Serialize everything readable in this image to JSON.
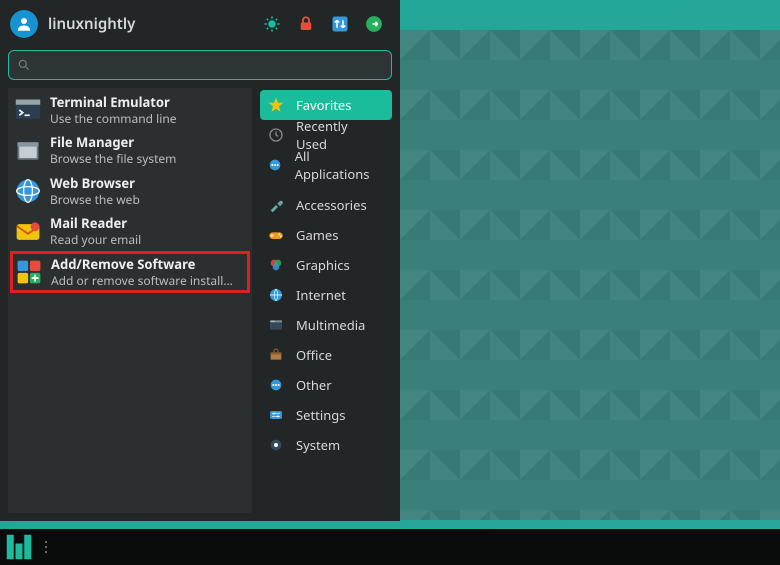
{
  "user": {
    "name": "linuxnightly"
  },
  "search": {
    "placeholder": ""
  },
  "header_actions": [
    {
      "name": "settings",
      "color": "#1abc9c"
    },
    {
      "name": "lock",
      "color": "#e74c3c"
    },
    {
      "name": "switch",
      "color": "#3498db"
    },
    {
      "name": "logout",
      "color": "#27ae60"
    }
  ],
  "favorites": [
    {
      "title": "Terminal Emulator",
      "desc": "Use the command line",
      "icon": "terminal",
      "highlight": false
    },
    {
      "title": "File Manager",
      "desc": "Browse the file system",
      "icon": "files",
      "highlight": false
    },
    {
      "title": "Web Browser",
      "desc": "Browse the web",
      "icon": "web",
      "highlight": false
    },
    {
      "title": "Mail Reader",
      "desc": "Read your email",
      "icon": "mail",
      "highlight": false
    },
    {
      "title": "Add/Remove Software",
      "desc": "Add or remove software install…",
      "icon": "software",
      "highlight": true
    }
  ],
  "categories": [
    {
      "label": "Favorites",
      "icon": "star",
      "selected": true
    },
    {
      "label": "Recently Used",
      "icon": "clock",
      "selected": false
    },
    {
      "label": "All Applications",
      "icon": "apps",
      "selected": false
    },
    {
      "label": "Accessories",
      "icon": "tools",
      "selected": false
    },
    {
      "label": "Games",
      "icon": "games",
      "selected": false
    },
    {
      "label": "Graphics",
      "icon": "graphics",
      "selected": false
    },
    {
      "label": "Internet",
      "icon": "internet",
      "selected": false
    },
    {
      "label": "Multimedia",
      "icon": "multimedia",
      "selected": false
    },
    {
      "label": "Office",
      "icon": "office",
      "selected": false
    },
    {
      "label": "Other",
      "icon": "other",
      "selected": false
    },
    {
      "label": "Settings",
      "icon": "settings",
      "selected": false
    },
    {
      "label": "System",
      "icon": "system",
      "selected": false
    }
  ],
  "colors": {
    "accent": "#1abc9c",
    "panel": "#222626",
    "highlight_border": "#e02020"
  }
}
